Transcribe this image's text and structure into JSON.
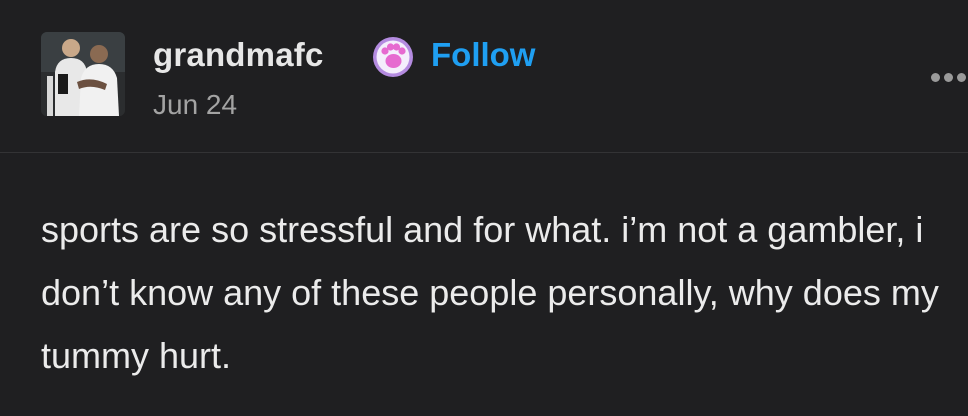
{
  "post": {
    "author": {
      "username": "grandmafc",
      "avatar_icon": "avatar-photo-two-footballers-hugging",
      "badge_icon": "pink-paw-badge-icon"
    },
    "follow_label": "Follow",
    "date": "Jun 24",
    "more_icon": "more-options-ellipsis-icon",
    "text": "sports are so stressful and for what. i’m not a gambler, i don’t know any of these people personally, why does my tummy hurt."
  },
  "colors": {
    "background": "#1f1f21",
    "username": "#e7e7e7",
    "follow": "#1f9ff2",
    "date": "#a3a3a3",
    "body_text": "#ebebeb",
    "badge_pink": "#e66ad0",
    "badge_ring": "#c7a5e8"
  }
}
